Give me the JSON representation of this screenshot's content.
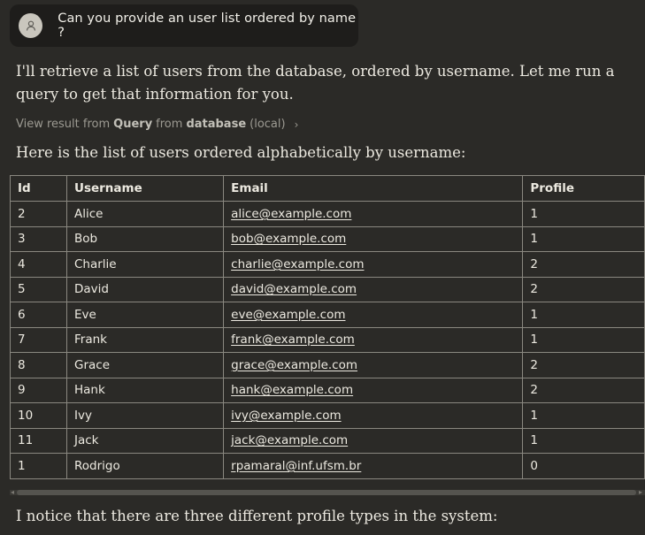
{
  "user_message": {
    "text": "Can you provide an user list ordered by name ?",
    "avatar_icon": "user-icon"
  },
  "assistant": {
    "intro": "I'll retrieve a list of users from the database, ordered by username. Let me run a query to get that information for you.",
    "tool_result": {
      "prefix": "View result from",
      "tool": "Query",
      "middle": "from",
      "source": "database",
      "suffix": "(local)",
      "icon": "chevron-right-icon"
    },
    "table_intro": "Here is the list of users ordered alphabetically by username:",
    "outro": "I notice that there are three different profile types in the system:"
  },
  "table": {
    "headers": [
      "Id",
      "Username",
      "Email",
      "Profile"
    ],
    "rows": [
      {
        "id": "2",
        "username": "Alice",
        "email": "alice@example.com",
        "profile": "1"
      },
      {
        "id": "3",
        "username": "Bob",
        "email": "bob@example.com",
        "profile": "1"
      },
      {
        "id": "4",
        "username": "Charlie",
        "email": "charlie@example.com",
        "profile": "2"
      },
      {
        "id": "5",
        "username": "David",
        "email": "david@example.com",
        "profile": "2"
      },
      {
        "id": "6",
        "username": "Eve",
        "email": "eve@example.com",
        "profile": "1"
      },
      {
        "id": "7",
        "username": "Frank",
        "email": "frank@example.com",
        "profile": "1"
      },
      {
        "id": "8",
        "username": "Grace",
        "email": "grace@example.com",
        "profile": "2"
      },
      {
        "id": "9",
        "username": "Hank",
        "email": "hank@example.com",
        "profile": "2"
      },
      {
        "id": "10",
        "username": "Ivy",
        "email": "ivy@example.com",
        "profile": "1"
      },
      {
        "id": "11",
        "username": "Jack",
        "email": "jack@example.com",
        "profile": "1"
      },
      {
        "id": "1",
        "username": "Rodrigo",
        "email": "rpamaral@inf.ufsm.br",
        "profile": "0"
      }
    ]
  },
  "colors": {
    "background": "#2b2a27",
    "bubble": "#1e1d1b",
    "text": "#ece9e0",
    "muted": "#9c9a92",
    "border": "#8a8880"
  }
}
